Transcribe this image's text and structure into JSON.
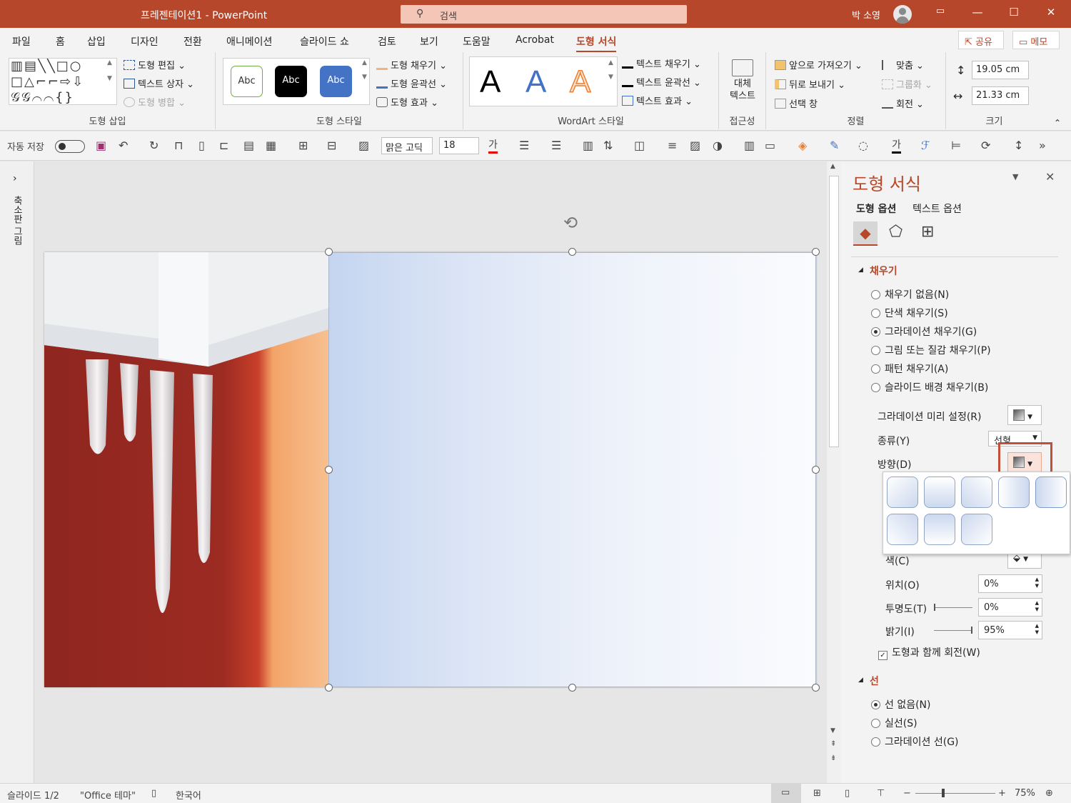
{
  "window": {
    "title": "프레젠테이션1 - PowerPoint",
    "search_placeholder": "검색",
    "user": "박 소영"
  },
  "menu": {
    "tabs": [
      "파일",
      "홈",
      "삽입",
      "디자인",
      "전환",
      "애니메이션",
      "슬라이드 쇼",
      "검토",
      "보기",
      "도움말",
      "Acrobat",
      "도형 서식"
    ],
    "active": "도형 서식",
    "share_label": "공유",
    "memo_label": "메모"
  },
  "ribbon": {
    "insert_shapes": {
      "label": "도형 삽입",
      "edit_shape": "도형 편집",
      "text_box": "텍스트 상자",
      "merge_shapes": "도형 병합"
    },
    "shape_styles": {
      "label": "도형 스타일",
      "sample": "Abc",
      "fill": "도형 채우기",
      "outline": "도형 윤곽선",
      "effects": "도형 효과"
    },
    "wordart": {
      "label": "WordArt 스타일",
      "letter": "A",
      "text_fill": "텍스트 채우기",
      "text_outline": "텍스트 윤곽선",
      "text_effects": "텍스트 효과"
    },
    "accessibility": {
      "label": "접근성",
      "alt_text_line1": "대체",
      "alt_text_line2": "텍스트"
    },
    "arrange": {
      "label": "정렬",
      "bring_forward": "앞으로 가져오기",
      "send_backward": "뒤로 보내기",
      "selection_pane": "선택 창",
      "align": "맞춤",
      "group": "그룹화",
      "rotate": "회전"
    },
    "size": {
      "label": "크기",
      "height": "19.05 cm",
      "width": "21.33 cm"
    }
  },
  "qat": {
    "autosave": "자동 저장",
    "font": "맑은 고딕",
    "font_size": "18"
  },
  "left_strip": {
    "thumbnails": "축소판 그림"
  },
  "pane": {
    "title": "도형 서식",
    "tab_shape": "도형 옵션",
    "tab_text": "텍스트 옵션",
    "fill_section": "채우기",
    "fill_options": [
      {
        "label": "채우기 없음(N)",
        "checked": false
      },
      {
        "label": "단색 채우기(S)",
        "checked": false
      },
      {
        "label": "그라데이션 채우기(G)",
        "checked": true
      },
      {
        "label": "그림 또는 질감 채우기(P)",
        "checked": false
      },
      {
        "label": "패턴 채우기(A)",
        "checked": false
      },
      {
        "label": "슬라이드 배경 채우기(B)",
        "checked": false
      }
    ],
    "preset_label": "그라데이션 미리 설정(R)",
    "type_label": "종류(Y)",
    "type_value": "선형",
    "direction_label": "방향(D)",
    "color_label": "색(C)",
    "position_label": "위치(O)",
    "position_value": "0%",
    "transparency_label": "투명도(T)",
    "transparency_value": "0%",
    "brightness_label": "밝기(I)",
    "brightness_value": "95%",
    "rotate_with_shape": "도형과 함께 회전(W)",
    "line_section": "선",
    "line_options": [
      {
        "label": "선 없음(N)",
        "checked": true
      },
      {
        "label": "실선(S)",
        "checked": false
      },
      {
        "label": "그라데이션 선(G)",
        "checked": false
      }
    ]
  },
  "status": {
    "slide": "슬라이드 1/2",
    "theme": "\"Office 테마\"",
    "language": "한국어",
    "zoom": "75%"
  },
  "colors": {
    "accent": "#b7472a",
    "gradient_start": "#c5d5f0",
    "gradient_end": "#fafbfe"
  }
}
